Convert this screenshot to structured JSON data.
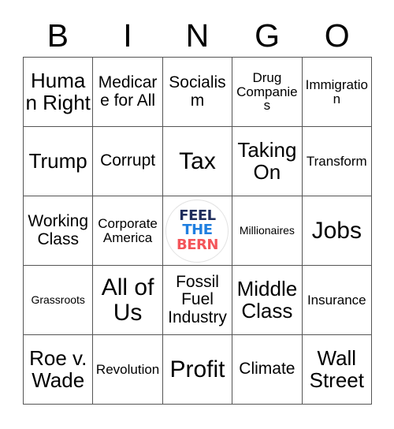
{
  "card": {
    "header_letters": [
      "B",
      "I",
      "N",
      "G",
      "O"
    ],
    "grid_size": 5,
    "rows": [
      [
        {
          "text": "Human Right",
          "size": "lg"
        },
        {
          "text": "Medicare for All",
          "size": "md"
        },
        {
          "text": "Socialism",
          "size": "md"
        },
        {
          "text": "Drug Companies",
          "size": "sm"
        },
        {
          "text": "Immigration",
          "size": "sm"
        }
      ],
      [
        {
          "text": "Trump",
          "size": "lg"
        },
        {
          "text": "Corrupt",
          "size": "md"
        },
        {
          "text": "Tax",
          "size": "xl"
        },
        {
          "text": "Taking On",
          "size": "lg"
        },
        {
          "text": "Transform",
          "size": "sm"
        }
      ],
      [
        {
          "text": "Working Class",
          "size": "md"
        },
        {
          "text": "Corporate America",
          "size": "sm"
        },
        {
          "text": "",
          "size": "free"
        },
        {
          "text": "Millionaires",
          "size": "xs"
        },
        {
          "text": "Jobs",
          "size": "xl"
        }
      ],
      [
        {
          "text": "Grassroots",
          "size": "xs"
        },
        {
          "text": "All of Us",
          "size": "xl"
        },
        {
          "text": "Fossil Fuel Industry",
          "size": "md"
        },
        {
          "text": "Middle Class",
          "size": "lg"
        },
        {
          "text": "Insurance",
          "size": "sm"
        }
      ],
      [
        {
          "text": "Roe v. Wade",
          "size": "lg"
        },
        {
          "text": "Revolution",
          "size": "sm"
        },
        {
          "text": "Profit",
          "size": "xl"
        },
        {
          "text": "Climate",
          "size": "md"
        },
        {
          "text": "Wall Street",
          "size": "lg"
        }
      ]
    ],
    "free_space": {
      "line1": "FEEL",
      "line2": "THE",
      "line3": "BERN",
      "colors": {
        "line1": "#1f2d5c",
        "line2": "#1f7fe0",
        "line3": "#f4555a"
      }
    },
    "colors": {
      "background": "#ffffff",
      "text": "#000000",
      "border": "#555555",
      "logo_ring": "#e2e2e2"
    }
  }
}
